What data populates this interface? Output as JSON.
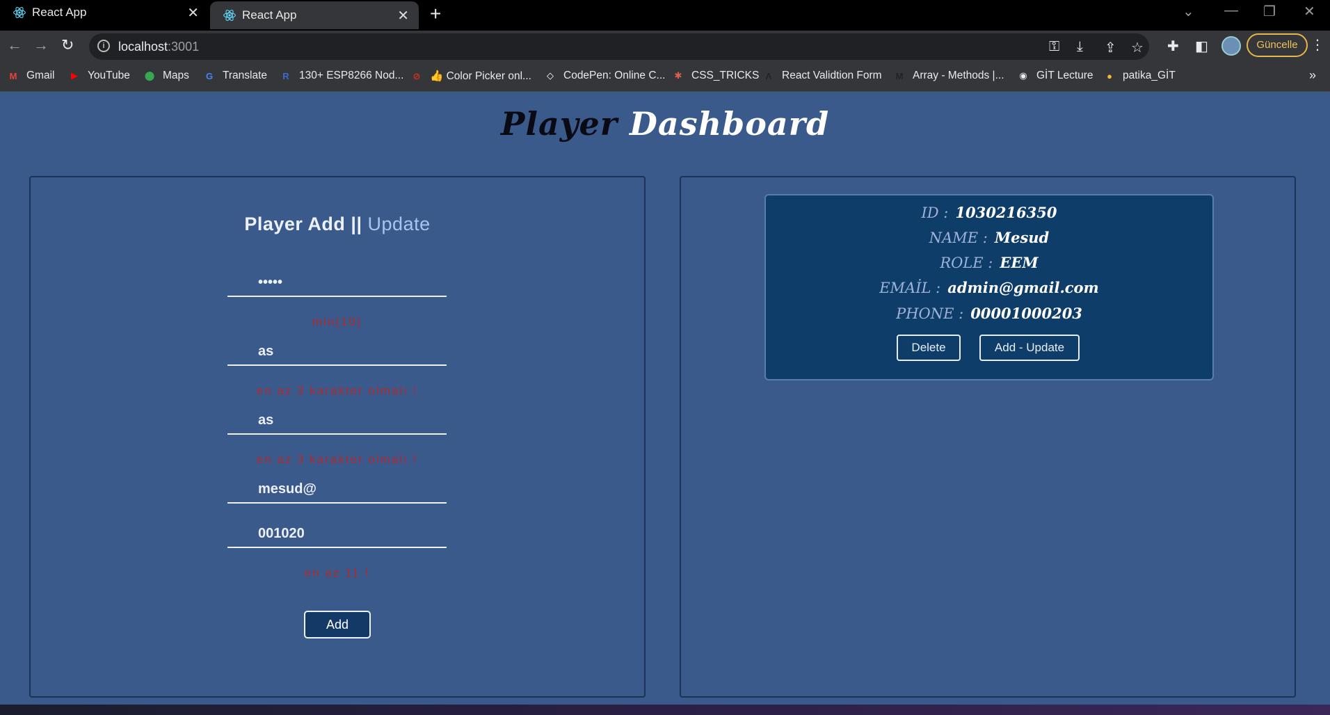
{
  "browser": {
    "tabs": [
      {
        "title": "React App",
        "active": false
      },
      {
        "title": "React App",
        "active": true
      }
    ],
    "url_host": "localhost",
    "url_port": ":3001",
    "update_label": "Güncelle",
    "bookmarks": [
      {
        "label": "Gmail",
        "icon": "gmail-icon",
        "color": "#ea4335",
        "glyph": "M"
      },
      {
        "label": "YouTube",
        "icon": "youtube-icon",
        "color": "#ff0000",
        "glyph": "▶"
      },
      {
        "label": "Maps",
        "icon": "maps-icon",
        "color": "#34a853",
        "glyph": "⬤"
      },
      {
        "label": "Translate",
        "icon": "translate-icon",
        "color": "#4285f4",
        "glyph": "G"
      },
      {
        "label": "130+ ESP8266 Nod...",
        "icon": "r-icon",
        "color": "#3b6bd4",
        "glyph": "R"
      },
      {
        "label": "👍 Color Picker onl...",
        "icon": "color-picker-icon",
        "color": "#d93025",
        "glyph": "⊘"
      },
      {
        "label": "CodePen: Online C...",
        "icon": "codepen-icon",
        "color": "#ffffff",
        "glyph": "◇"
      },
      {
        "label": "CSS_TRICKS",
        "icon": "css-tricks-icon",
        "color": "#e0604a",
        "glyph": "✱"
      },
      {
        "label": "React Validtion Form",
        "icon": "react-validation-icon",
        "color": "#222222",
        "glyph": "Λ"
      },
      {
        "label": "Array - Methods |...",
        "icon": "array-methods-icon",
        "color": "#222222",
        "glyph": "M"
      },
      {
        "label": "GİT Lecture",
        "icon": "globe-icon",
        "color": "#e8eaed",
        "glyph": "◉"
      },
      {
        "label": "patika_GİT",
        "icon": "patika-icon",
        "color": "#f5b82e",
        "glyph": "●"
      }
    ]
  },
  "page": {
    "title_dark": "Player",
    "title_light": "Dashboard"
  },
  "form": {
    "title_main": "Player Add ||",
    "title_accent": "Update",
    "fields": [
      {
        "value": "•••••",
        "error": "min(10)"
      },
      {
        "value": "as",
        "error": "en az 3 karakter olmalı !"
      },
      {
        "value": "as",
        "error": "en az 3 karakter olmalı !"
      },
      {
        "value": "mesud@",
        "error": ""
      },
      {
        "value": "001020",
        "error": "en az 11 !"
      }
    ],
    "submit_label": "Add"
  },
  "card": {
    "rows": [
      {
        "label": "ID :",
        "value": "1030216350"
      },
      {
        "label": "NAME :",
        "value": "Mesud"
      },
      {
        "label": "ROLE :",
        "value": "EEM"
      },
      {
        "label": "EMAİL :",
        "value": "admin@gmail.com"
      },
      {
        "label": "PHONE :",
        "value": "00001000203"
      }
    ],
    "delete_label": "Delete",
    "update_label": "Add - Update"
  }
}
